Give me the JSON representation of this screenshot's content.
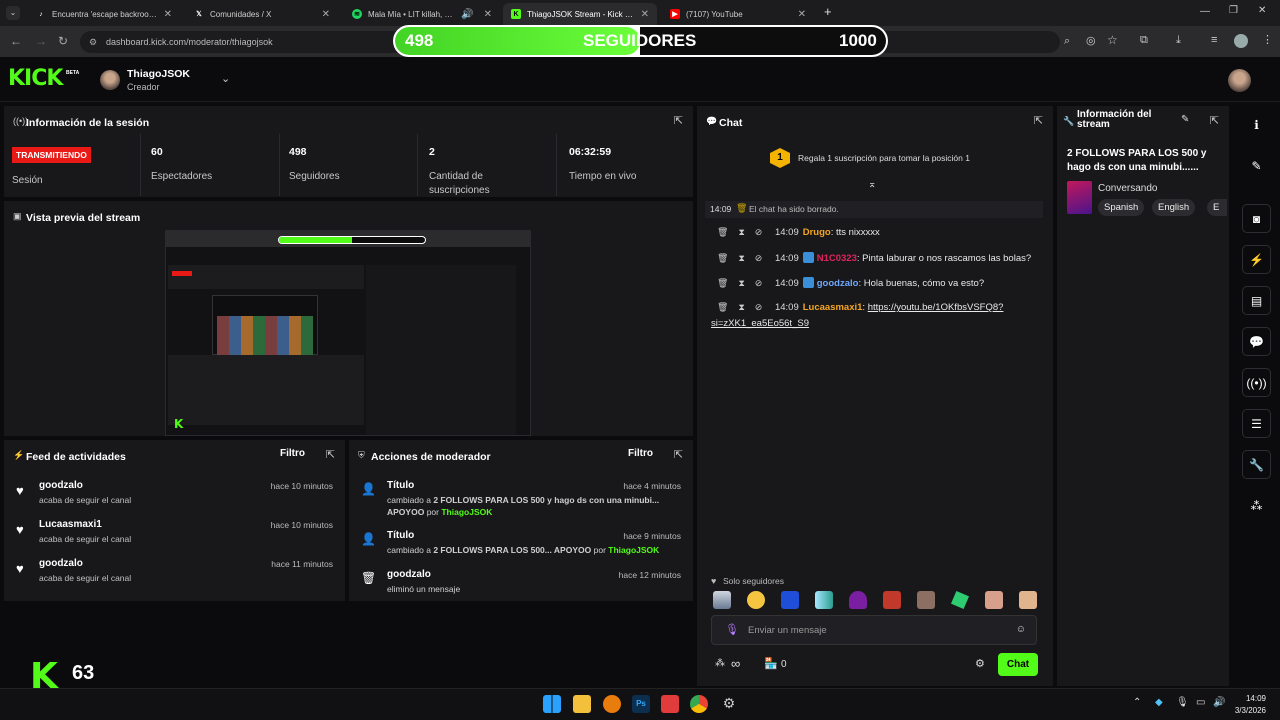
{
  "browser": {
    "tabs": [
      {
        "label": "Encuentra 'escape backrooms' h",
        "icon": "tiktok-icon"
      },
      {
        "label": "Comunidades / X",
        "icon": "x-icon"
      },
      {
        "label": "Mala Mía • LIT killah, Duki",
        "icon": "spotify-icon"
      },
      {
        "label": "ThiagoJSOK Stream - Kick Dash",
        "icon": "kick-icon"
      },
      {
        "label": "(7107) YouTube",
        "icon": "youtube-icon"
      }
    ],
    "new_tab": "+",
    "url": "dashboard.kick.com/moderator/thiagojsok"
  },
  "follower_bar": {
    "current": "498",
    "label": "SEGUIDORES",
    "goal": "1000",
    "progress": 0.498
  },
  "header": {
    "logo": "KICK",
    "beta": "BETA",
    "username": "ThiagoJSOK",
    "role": "Creador"
  },
  "session": {
    "title": "Información de la sesión",
    "status": "TRANSMITIENDO",
    "status_label": "Sesión",
    "stats": [
      {
        "value": "60",
        "label": "Espectadores"
      },
      {
        "value": "498",
        "label": "Seguidores"
      },
      {
        "value": "2",
        "label": "Cantidad de suscripciones"
      },
      {
        "value": "06:32:59",
        "label": "Tiempo en vivo"
      }
    ]
  },
  "preview": {
    "title": "Vista previa del stream"
  },
  "feed": {
    "title": "Feed de actividades",
    "filter": "Filtro",
    "items": [
      {
        "name": "goodzalo",
        "action": "acaba de seguir el canal",
        "time": "hace 10 minutos"
      },
      {
        "name": "Lucaasmaxi1",
        "action": "acaba de seguir el canal",
        "time": "hace 10 minutos"
      },
      {
        "name": "goodzalo",
        "action": "acaba de seguir el canal",
        "time": "hace 11 minutos"
      }
    ]
  },
  "mod": {
    "title": "Acciones de moderador",
    "filter": "Filtro",
    "items": [
      {
        "name": "Título",
        "pre": "cambiado a",
        "detail": "2 FOLLOWS PARA LOS 500 y hago ds con una minubi... APOYOO",
        "by": "por",
        "user": "ThiagoJSOK",
        "time": "hace 4 minutos"
      },
      {
        "name": "Título",
        "pre": "cambiado a",
        "detail": "2 FOLLOWS PARA LOS 500... APOYOO",
        "by": "por",
        "user": "ThiagoJSOK",
        "time": "hace 9 minutos"
      },
      {
        "name": "goodzalo",
        "pre": "eliminó un mensaje",
        "detail": "",
        "by": "",
        "user": "",
        "time": "hace 12 minutos"
      }
    ]
  },
  "chat": {
    "title": "Chat",
    "sub_rank": "1",
    "sub_prompt": "Regala 1 suscripción para tomar la posición 1",
    "cleared_time": "14:09",
    "cleared_text": "El chat ha sido borrado.",
    "messages": [
      {
        "time": "14:09",
        "user": "Drugo",
        "color": "#f5a623",
        "text": "tts nixxxxx",
        "badge": false
      },
      {
        "time": "14:09",
        "user": "N1C0323",
        "color": "#e0245e",
        "text": "Pinta laburar o nos rascamos las bolas?",
        "badge": true
      },
      {
        "time": "14:09",
        "user": "goodzalo",
        "color": "#6ea8ff",
        "text": "Hola buenas, cómo va esto?",
        "badge": true
      },
      {
        "time": "14:09",
        "user": "Lucaasmaxi1",
        "color": "#f5a623",
        "text": "https://youtu.be/1OKfbsVSFQ8?",
        "text2": "si=zXK1_ea5Eo56t_S9",
        "badge": false
      }
    ],
    "followers_only": "Solo seguidores",
    "placeholder": "Enviar un mensaje",
    "count": "0",
    "send": "Chat",
    "infinity": "∞"
  },
  "stream_info": {
    "title": "Información del stream",
    "stream_title": "2 FOLLOWS PARA LOS 500 y hago ds con una minubi......",
    "category": "Conversando",
    "tags": [
      "Spanish",
      "English",
      "E"
    ]
  },
  "overlay": {
    "logo": "K",
    "viewers": "63"
  },
  "taskbar": {
    "time": "14:09",
    "date": "3/3/2026"
  }
}
